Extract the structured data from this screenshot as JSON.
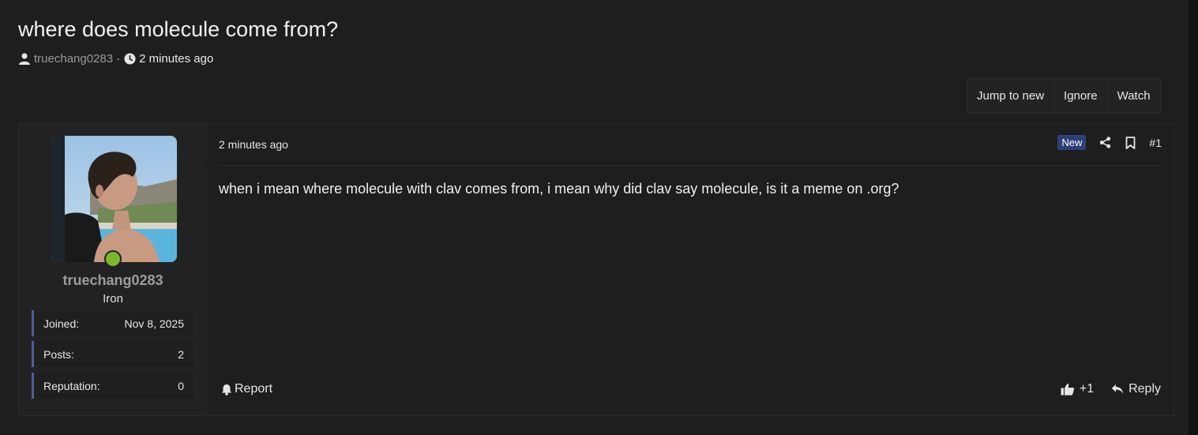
{
  "thread": {
    "title": "where does molecule come from?",
    "author": "truechang0283",
    "separator": "·",
    "time": "2 minutes ago"
  },
  "actions": [
    "Jump to new",
    "Ignore",
    "Watch"
  ],
  "post": {
    "time": "2 minutes ago",
    "badge": "New",
    "number": "#1",
    "body": "when i mean where molecule with clav comes from, i mean why did clav say molecule, is it a meme on .org?",
    "report_label": "Report",
    "likes": "+1",
    "reply_label": "Reply"
  },
  "user": {
    "name": "truechang0283",
    "rank": "Iron",
    "stats": [
      {
        "label": "Joined:",
        "value": "Nov 8, 2025"
      },
      {
        "label": "Posts:",
        "value": "2"
      },
      {
        "label": "Reputation:",
        "value": "0"
      }
    ]
  },
  "colors": {
    "accent": "#4d5f9f",
    "new_badge": "#2c3f79",
    "online": "#7cb82f"
  }
}
